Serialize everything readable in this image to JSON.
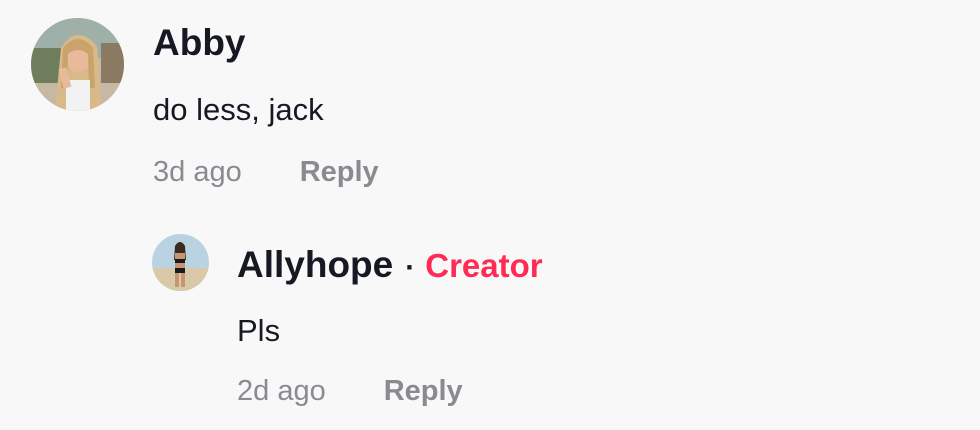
{
  "comments": [
    {
      "author": "Abby",
      "text": "do less, jack",
      "time": "3d ago",
      "reply_label": "Reply",
      "avatar_icon": "user-avatar-photo"
    }
  ],
  "replies": [
    {
      "author": "Allyhope",
      "separator": "·",
      "badge": "Creator",
      "text": "Pls",
      "time": "2d ago",
      "reply_label": "Reply",
      "avatar_icon": "user-avatar-photo"
    }
  ],
  "colors": {
    "background": "#f8f8f8",
    "text": "#161823",
    "muted": "#8a8b91",
    "creator_badge": "#fe2c55"
  }
}
